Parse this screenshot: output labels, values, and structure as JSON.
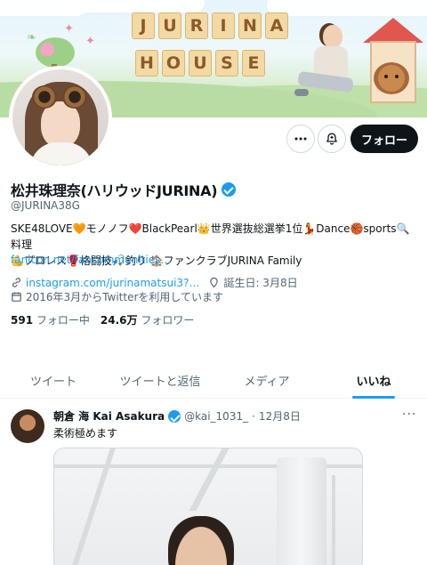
{
  "banner": {
    "title_line1": [
      "J",
      "U",
      "R",
      "I",
      "N",
      "A"
    ],
    "title_line2": [
      "H",
      "O",
      "U",
      "S",
      "E"
    ]
  },
  "actions": {
    "more_icon": "more-horizontal-icon",
    "notify_icon": "bell-plus-icon",
    "follow_label": "フォロー"
  },
  "profile": {
    "name": "松井珠理奈(ハリウッドJURINA)",
    "handle": "@JURINA38G",
    "bio_line1": "SKE48LOVE🧡モノノフ❤️BlackPearl👑世界選抜総選挙1位💃Dance🏀sports🔍料理",
    "bio_line2": "💪プロレス🥊格闘技🎣釣り 🏠ファンクラブJURINA Family",
    "bio_link": "fanicon.net/fancommunities…",
    "website": "instagram.com/jurinamatsui3?…",
    "birthday": "誕生日: 3月8日",
    "joined": "2016年3月からTwitterを利用しています",
    "following_count": "591",
    "following_label": "フォロー中",
    "followers_count": "24.6万",
    "followers_label": "フォロワー"
  },
  "tabs": [
    {
      "label": "ツイート",
      "active": false
    },
    {
      "label": "ツイートと返信",
      "active": false
    },
    {
      "label": "メディア",
      "active": false
    },
    {
      "label": "いいね",
      "active": true
    }
  ],
  "tweet": {
    "author_name": "朝倉 海 Kai Asakura",
    "author_handle": "@kai_1031_",
    "date": "12月8日",
    "text": "柔術極めます"
  },
  "colors": {
    "accent": "#1d9bf0",
    "text": "#0f1419",
    "muted": "#536471",
    "follow_button": "#0f1419"
  }
}
